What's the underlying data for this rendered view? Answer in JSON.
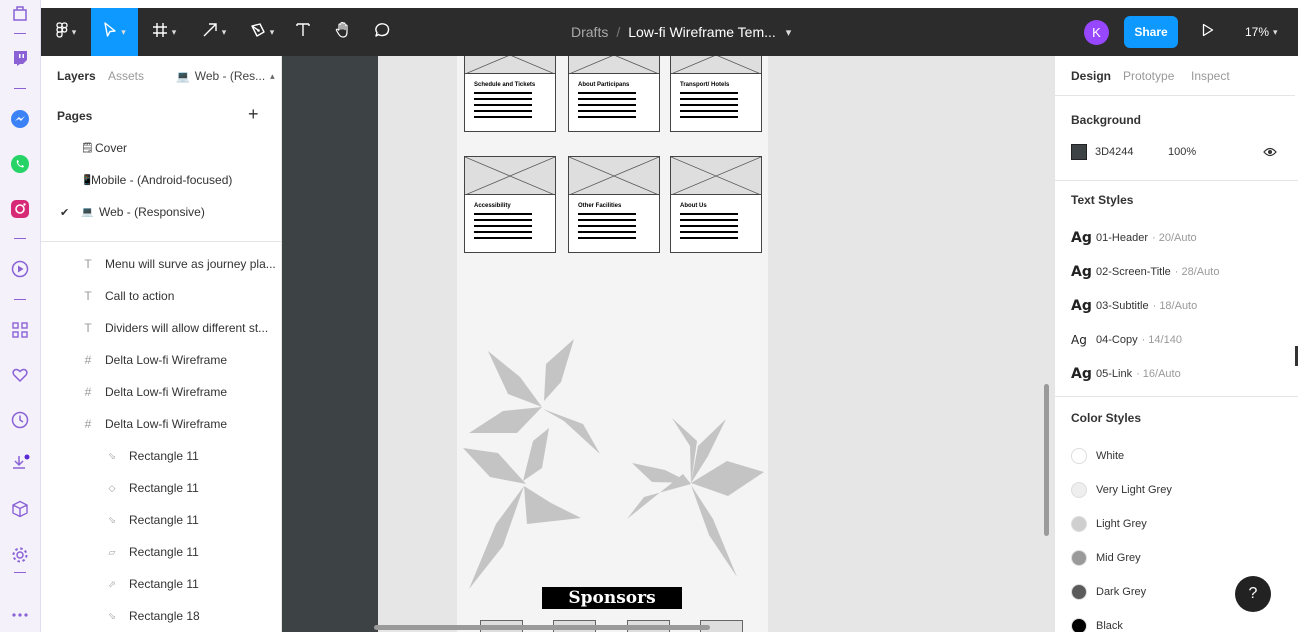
{
  "toolbar": {
    "breadcrumb_parent": "Drafts",
    "breadcrumb_sep": "/",
    "file_name": "Low-fi Wireframe Tem...",
    "file_caret": "⌄",
    "avatar_initial": "K",
    "share_label": "Share",
    "zoom_label": "17%"
  },
  "left_panel": {
    "tabs": {
      "layers": "Layers",
      "assets": "Assets",
      "page_select": "Web - (Res..."
    },
    "pages_header": "Pages",
    "pages_add": "+",
    "pages": [
      {
        "icon": "🗒",
        "label": "Cover"
      },
      {
        "icon": "📱",
        "label": "Mobile - (Android-focused)"
      },
      {
        "icon": "💻",
        "label": "Web - (Responsive)",
        "checked": true
      }
    ],
    "layers": [
      {
        "type": "text",
        "label": "Menu will surve as journey pla..."
      },
      {
        "type": "text",
        "label": "Call to action"
      },
      {
        "type": "text",
        "label": "Dividers will allow different st..."
      },
      {
        "type": "frame",
        "label": "Delta Low-fi Wireframe"
      },
      {
        "type": "frame",
        "label": "Delta Low-fi Wireframe"
      },
      {
        "type": "frame",
        "label": "Delta Low-fi Wireframe"
      },
      {
        "type": "shape",
        "label": "Rectangle 11"
      },
      {
        "type": "shape",
        "label": "Rectangle 11"
      },
      {
        "type": "shape",
        "label": "Rectangle 11"
      },
      {
        "type": "shape",
        "label": "Rectangle 11"
      },
      {
        "type": "shape",
        "label": "Rectangle 11"
      },
      {
        "type": "shape",
        "label": "Rectangle 18"
      }
    ]
  },
  "canvas": {
    "cards_row1": [
      "Schedule and Tickets",
      "About Participans",
      "Transport/ Hotels"
    ],
    "cards_row2": [
      "Accessibility",
      "Other Facilities",
      "About Us"
    ],
    "sponsors_label": "Sponsors"
  },
  "right_panel": {
    "tabs": {
      "design": "Design",
      "prototype": "Prototype",
      "inspect": "Inspect"
    },
    "background_header": "Background",
    "background_hex": "3D4244",
    "background_opacity": "100%",
    "background_color": "#3D4244",
    "text_styles_header": "Text Styles",
    "text_styles": [
      {
        "ag": "Ag",
        "name": "01-Header",
        "meta": "· 20/Auto"
      },
      {
        "ag": "Ag",
        "name": "02-Screen-Title",
        "meta": "· 28/Auto"
      },
      {
        "ag": "Ag",
        "name": "03-Subtitle",
        "meta": "· 18/Auto"
      },
      {
        "ag": "Ag",
        "name": "04-Copy",
        "meta": "· 14/140"
      },
      {
        "ag": "Ag",
        "name": "05-Link",
        "meta": "· 16/Auto"
      }
    ],
    "color_styles_header": "Color Styles",
    "color_styles": [
      {
        "name": "White",
        "color": "#FFFFFF"
      },
      {
        "name": "Very Light Grey",
        "color": "#EEEEEE"
      },
      {
        "name": "Light Grey",
        "color": "#CFCFCF"
      },
      {
        "name": "Mid Grey",
        "color": "#9A9A9A"
      },
      {
        "name": "Dark Grey",
        "color": "#5A5A5A"
      },
      {
        "name": "Black",
        "color": "#000000"
      }
    ],
    "help_label": "?"
  },
  "colors": {
    "accent": "#0D99FF",
    "toolbar_bg": "#2C2C2C",
    "browser_accent": "#8A62D6"
  }
}
